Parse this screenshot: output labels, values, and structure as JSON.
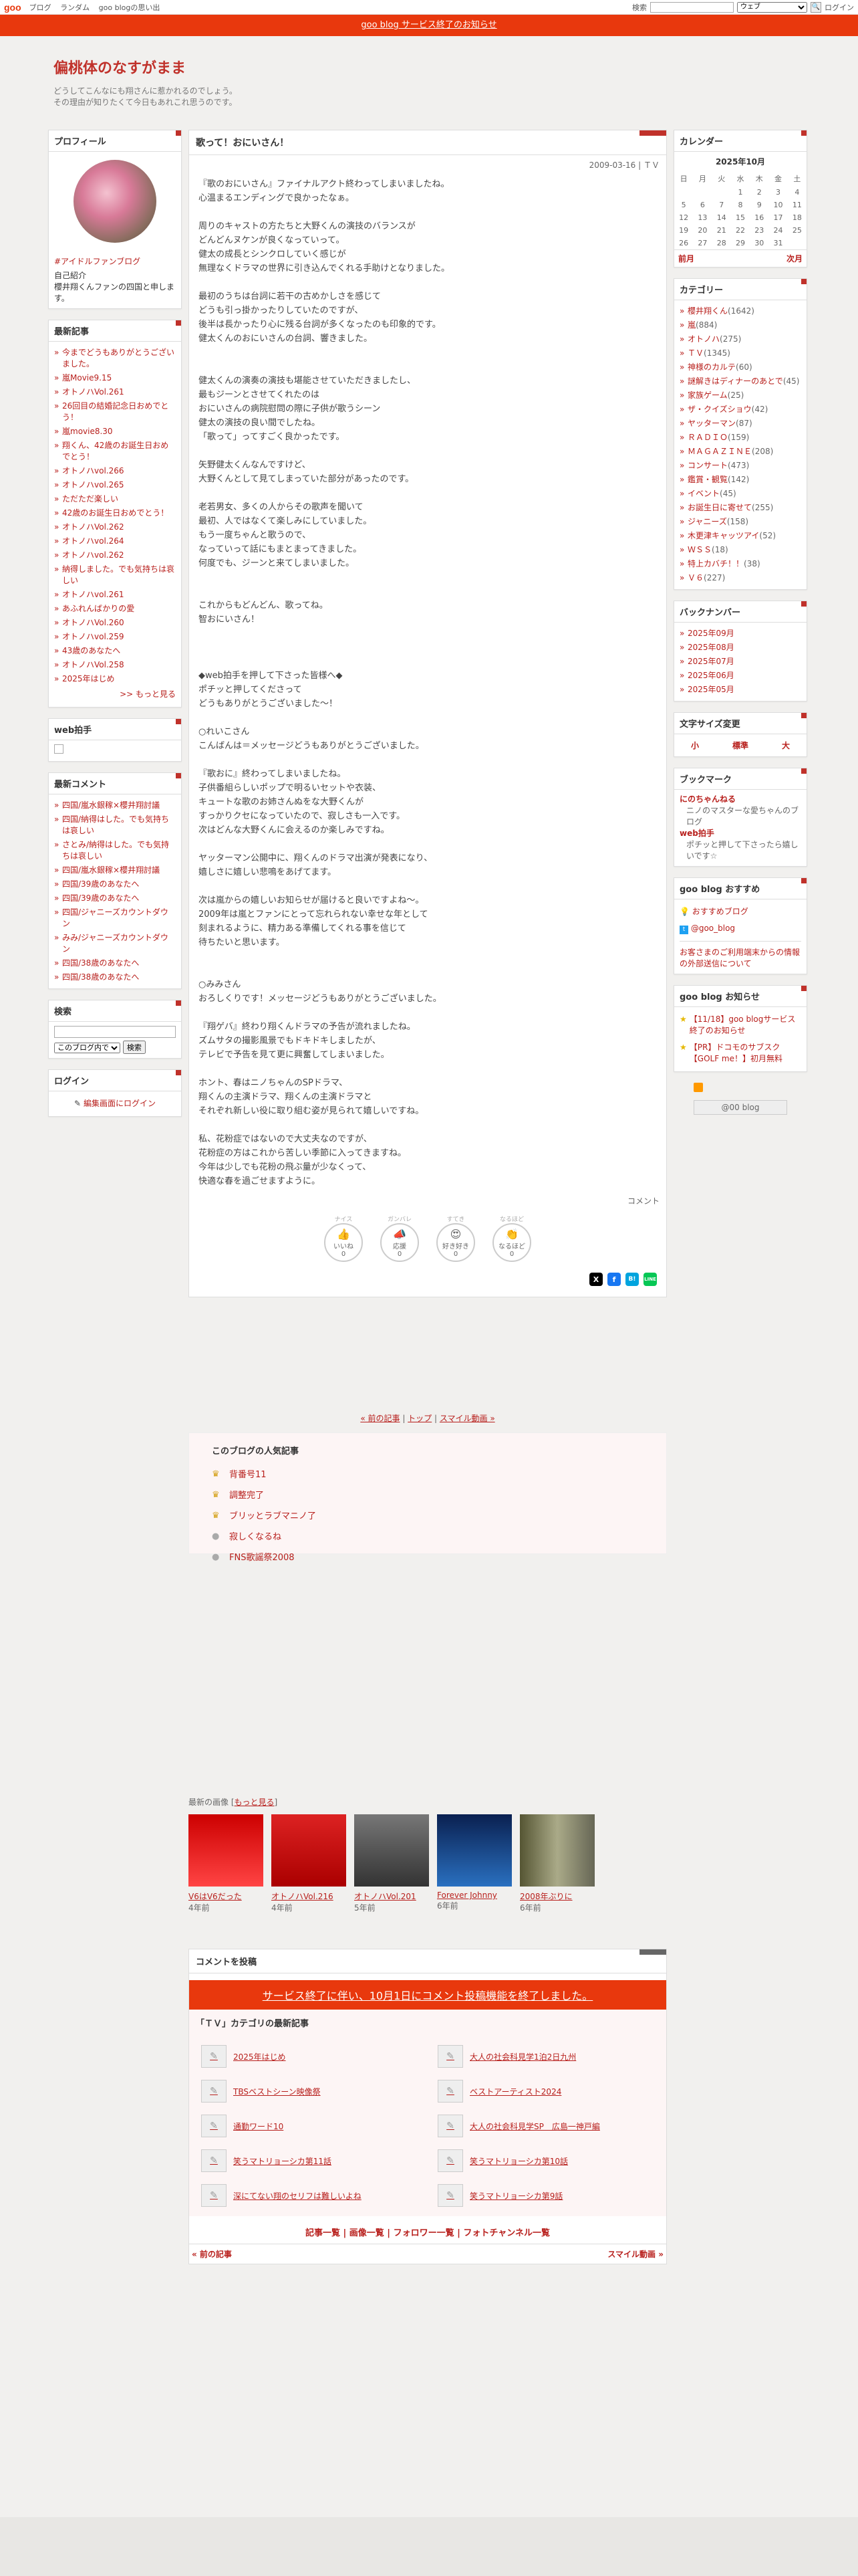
{
  "topbar": {
    "logo": "goo",
    "nav": [
      "ブログ",
      "ランダム",
      "goo blogの思い出"
    ],
    "search_label": "検索",
    "search_select": "ウェブ",
    "search_btn": "🔍",
    "login": "ログイン"
  },
  "notice": "goo blog サービス終了のお知らせ",
  "header": {
    "title": "偏桃体のなすがまま",
    "desc1": "どうしてこんなにも翔さんに惹かれるのでしょう。",
    "desc2": "その理由が知りたくて今日もあれこれ思うのです。"
  },
  "profile": {
    "title": "プロフィール",
    "tag": "#アイドルファンブログ",
    "self_label": "自己紹介",
    "self_text": "櫻井翔くんファンの四国と申します。"
  },
  "recent": {
    "title": "最新記事",
    "items": [
      "今までどうもありがとうございました。",
      "嵐Movie9.15",
      "オトノハVol.261",
      "26回目の結婚記念日おめでとう！",
      "嵐movie8.30",
      "翔くん、42歳のお誕生日おめでとう！",
      "オトノハvol.266",
      "オトノハvol.265",
      "ただただ楽しい",
      "42歳のお誕生日おめでとう！",
      "オトノハVol.262",
      "オトノハvol.264",
      "オトノハvol.262",
      "納得しました。でも気持ちは哀しい",
      "オトノハvol.261",
      "あふれんばかりの愛",
      "オトノハVol.260",
      "オトノハvol.259",
      "43歳のあなたへ",
      "オトノハVol.258",
      "2025年はじめ"
    ],
    "more": ">> もっと見る"
  },
  "webclap": {
    "title": "web拍手"
  },
  "comments": {
    "title": "最新コメント",
    "items": [
      "四国/嵐水銀稼×櫻井翔討議",
      "四国/納得はした。でも気持ちは哀しい",
      "さとみ/納得はした。でも気持ちは哀しい",
      "四国/嵐水銀稼×櫻井翔討議",
      "四国/39歳のあなたへ",
      "四国/39歳のあなたへ",
      "四国/ジャニーズカウントダウン",
      "みみ/ジャニーズカウントダウン",
      "四国/38歳のあなたへ",
      "四国/38歳のあなたへ"
    ]
  },
  "search": {
    "title": "検索",
    "select": "このブログ内で",
    "btn": "検索"
  },
  "login": {
    "title": "ログイン",
    "link": "編集画面にログイン"
  },
  "article": {
    "title": "歌って！おにいさん！",
    "date": "2009-03-16 | ＴＶ",
    "body": "『歌のおにいさん』ファイナルアクト終わってしまいましたね。\n心温まるエンディングで良かったなぁ。\n\n周りのキャストの方たちと大野くんの演技のバランスが\nどんどんヌケンが良くなっていって。\n健太の成長とシンクロしていく感じが\n無理なくドラマの世界に引き込んでくれる手助けとなりました。\n\n最初のうちは台詞に若干の古めかしさを感じて\nどうも引っ掛かったりしていたのですが、\n後半は長かったり心に残る台詞が多くなったのも印象的です。\n健太くんのおにいさんの台詞、響きました。\n\n\n健太くんの演奏の演技も堪能させていただきましたし、\n最もジーンとさせてくれたのは\nおにいさんの病院慰問の際に子供が歌うシーン\n健太の演技の良い間でしたね。\n「歌って」ってすごく良かったです。\n\n矢野健太くんなんですけど、\n大野くんとして見てしまっていた部分があったのです。\n\n老若男女、多くの人からその歌声を聞いて\n最初、人ではなくて楽しみにしていました。\nもう一度ちゃんと歌うので、\nなっていって話にもまとまってきました。\n何度でも、ジーンと来てしまいました。\n\n\nこれからもどんどん、歌ってね。\n智おにいさん！\n\n\n\n◆web拍手を押して下さった皆様へ◆\nポチッと押してくださって\nどうもありがとうございました～！\n\n○れいこさん\nこんばんは＝メッセージどうもありがとうございました。\n\n『歌おに』終わってしまいましたね。\n子供番組らしいポップで明るいセットや衣装、\nキュートな歌のお姉さんぬをな大野くんが\nすっかりクセになっていたので、寂しさも一入です。\n次はどんな大野くんに会えるのか楽しみですね。\n\nヤッターマン公開中に、翔くんのドラマ出演が発表になり、\n嬉しさに嬉しい悲鳴をあげてます。\n\n次は嵐からの嬉しいお知らせが届けると良いですよね〜。\n2009年は嵐とファンにとって忘れられない幸せな年として\n刻まれるように、精力ある準備してくれる事を信じて\n待ちたいと思います。\n\n\n○みみさん\nおろしくりです！メッセージどうもありがとうございました。\n\n『翔ゲバ』終わり翔くんドラマの予告が流れましたね。\nズムサタの撮影風景でもドキドキしましたが、\nテレビで予告を見て更に興奮してしまいました。\n\nホント、春はニノちゃんのSPドラマ、\n翔くんの主演ドラマ、翔くんの主演ドラマと\nそれぞれ新しい役に取り組む姿が見られて嬉しいですね。\n\n私、花粉症ではないので大丈夫なのですが、\n花粉症の方はこれから苦しい季節に入ってきますね。\n今年は少しでも花粉の飛ぶ量が少なくって、\n快適な春を過ごせますように。",
    "foot": "コメント"
  },
  "reactions": [
    {
      "label": "ナイス",
      "emoji": "👍",
      "name": "いいね",
      "count": "0"
    },
    {
      "label": "ガンバレ",
      "emoji": "📣",
      "name": "応援",
      "count": "0"
    },
    {
      "label": "すてき",
      "emoji": "😍",
      "name": "好き好き",
      "count": "0"
    },
    {
      "label": "なるほど",
      "emoji": "👏",
      "name": "なるほど",
      "count": "0"
    }
  ],
  "share": [
    "X",
    "f",
    "B!",
    "LINE"
  ],
  "pager": {
    "prev": "« 前の記事",
    "top": "トップ",
    "smile": "スマイル動画 »"
  },
  "popular": {
    "title": "このブログの人気記事",
    "items": [
      "背番号11",
      "調整完了",
      "ブリッとラブマニノ了",
      "寂しくなるね",
      "FNS歌謡祭2008"
    ]
  },
  "images": {
    "head": "最新の画像",
    "more": "もっと見る",
    "items": [
      {
        "title": "V6はV6だった",
        "age": "4年前"
      },
      {
        "title": "オトノハVol.216",
        "age": "4年前"
      },
      {
        "title": "オトノハVol.201",
        "age": "5年前"
      },
      {
        "title": "Forever Johnny",
        "age": "6年前"
      },
      {
        "title": "2008年ぶりに",
        "age": "6年前"
      }
    ]
  },
  "commentForm": {
    "title": "コメントを投稿",
    "closed": "サービス終了に伴い、10月1日にコメント投稿機能を終了しました。"
  },
  "catArticles": {
    "title": "「ＴＶ」カテゴリの最新記事",
    "items": [
      "2025年はじめ",
      "大人の社会科見学1泊2日九州",
      "TBSベストシーン映像祭",
      "ベストアーティスト2024",
      "通勤ワード10",
      "大人の社会科見学SP　広島一神戸編",
      "笑うマトリョーシカ第11話",
      "笑うマトリョーシカ第10話",
      "深にてない翔のセリフは難しいよね",
      "笑うマトリョーシカ第9話"
    ]
  },
  "footlinks": "記事一覧 | 画像一覧 | フォロワー一覧 | フォトチャンネル一覧",
  "footnav": {
    "prev": "« 前の記事",
    "next": "スマイル動画 »"
  },
  "calendar": {
    "title": "カレンダー",
    "month": "2025年10月",
    "days": [
      "日",
      "月",
      "火",
      "水",
      "木",
      "金",
      "土"
    ],
    "weeks": [
      [
        "",
        "",
        "",
        "1",
        "2",
        "3",
        "4"
      ],
      [
        "5",
        "6",
        "7",
        "8",
        "9",
        "10",
        "11"
      ],
      [
        "12",
        "13",
        "14",
        "15",
        "16",
        "17",
        "18"
      ],
      [
        "19",
        "20",
        "21",
        "22",
        "23",
        "24",
        "25"
      ],
      [
        "26",
        "27",
        "28",
        "29",
        "30",
        "31",
        ""
      ]
    ],
    "prev": "前月",
    "next": "次月"
  },
  "categories": {
    "title": "カテゴリー",
    "items": [
      [
        "櫻井翔くん",
        "1642"
      ],
      [
        "嵐",
        "884"
      ],
      [
        "オトノハ",
        "275"
      ],
      [
        "ＴＶ",
        "1345"
      ],
      [
        "神様のカルテ",
        "60"
      ],
      [
        "謎解きはディナーのあとで",
        "45"
      ],
      [
        "家族ゲーム",
        "25"
      ],
      [
        "ザ・クイズショウ",
        "42"
      ],
      [
        "ヤッターマン",
        "87"
      ],
      [
        "ＲＡＤＩＯ",
        "159"
      ],
      [
        "ＭＡＧＡＺＩＮＥ",
        "208"
      ],
      [
        "コンサート",
        "473"
      ],
      [
        "鑑賞・観覧",
        "142"
      ],
      [
        "イベント",
        "45"
      ],
      [
        "お誕生日に寄せて",
        "255"
      ],
      [
        "ジャニーズ",
        "158"
      ],
      [
        "木更津キャッツアイ",
        "52"
      ],
      [
        "ＷＳＳ",
        "18"
      ],
      [
        "特上カバチ！！",
        "38"
      ],
      [
        "Ｖ６",
        "227"
      ]
    ]
  },
  "backnumber": {
    "title": "バックナンバー",
    "items": [
      "2025年09月",
      "2025年08月",
      "2025年07月",
      "2025年06月",
      "2025年05月"
    ]
  },
  "fontsize": {
    "title": "文字サイズ変更",
    "items": [
      "小",
      "標準",
      "大"
    ]
  },
  "bookmark": {
    "title": "ブックマーク",
    "items": [
      {
        "name": "にのちゃんねる",
        "desc": "ニノのマスターな愛ちゃんのブログ"
      },
      {
        "name": "web拍手",
        "desc": "ポチッと押して下さったら嬉しいです☆"
      }
    ]
  },
  "goorec": {
    "title": "goo blog おすすめ",
    "items": [
      "おすすめブログ",
      "@goo_blog"
    ],
    "alert": "お客さまのご利用端末からの情報の外部送信について"
  },
  "gooinfo": {
    "title": "goo blog お知らせ",
    "items": [
      "【11/18】goo blogサービス終了のお知らせ",
      "【PR】ドコモのサブスク【GOLF me！】初月無料"
    ]
  },
  "goologo": "@00 blog"
}
